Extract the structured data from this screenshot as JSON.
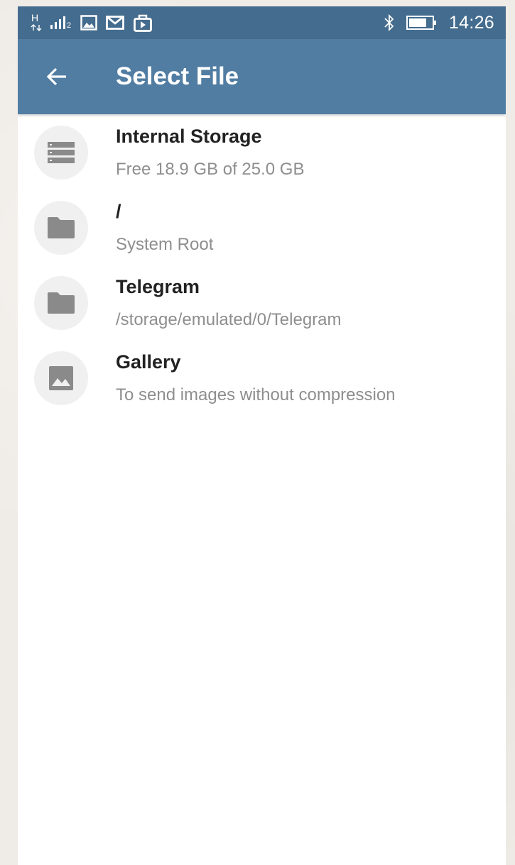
{
  "status_bar": {
    "network_type": "H",
    "sim_slot": "2",
    "time": "14:26",
    "icons": [
      "network-type-icon",
      "signal-icon",
      "image-notification-icon",
      "gmail-icon",
      "media-icon",
      "bluetooth-icon",
      "battery-icon"
    ]
  },
  "app_bar": {
    "title": "Select File",
    "back_icon": "arrow-left-icon",
    "background": "#517da2"
  },
  "colors": {
    "status_bar": "#446c8e",
    "icon": "#8a8a8a",
    "icon_circle": "#f0f0f0",
    "title_text": "#222222",
    "subtitle_text": "#8e8e8e"
  },
  "items": [
    {
      "title": "Internal Storage",
      "subtitle": "Free 18.9 GB of 25.0 GB",
      "icon": "storage-icon"
    },
    {
      "title": "/",
      "subtitle": "System Root",
      "icon": "folder-icon"
    },
    {
      "title": "Telegram",
      "subtitle": "/storage/emulated/0/Telegram",
      "icon": "folder-icon"
    },
    {
      "title": "Gallery",
      "subtitle": "To send images without compression",
      "icon": "image-icon"
    }
  ]
}
